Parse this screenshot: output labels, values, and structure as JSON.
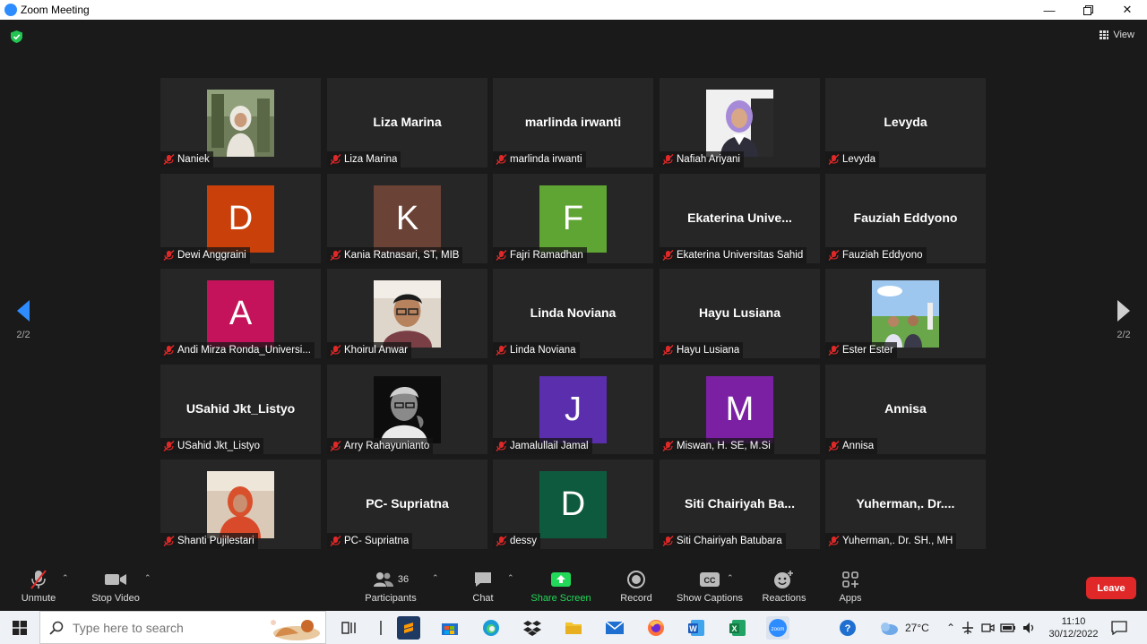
{
  "window": {
    "title": "Zoom Meeting"
  },
  "view_label": "View",
  "pagination": {
    "left": "2/2",
    "right": "2/2"
  },
  "tiles": [
    {
      "name": "Naniek",
      "kind": "photo",
      "photo": "photo-woman-hijab-garden"
    },
    {
      "name": "Liza Marina",
      "kind": "text",
      "display": "Liza Marina"
    },
    {
      "name": "marlinda irwanti",
      "kind": "text",
      "display": "marlinda irwanti"
    },
    {
      "name": "Nafiah Ariyani",
      "kind": "photo",
      "photo": "photo-woman-hijab-purple"
    },
    {
      "name": "Levyda",
      "kind": "text",
      "display": "Levyda"
    },
    {
      "name": "Dewi Anggraini",
      "kind": "avatar",
      "letter": "D",
      "color": "#c9400b"
    },
    {
      "name": "Kania Ratnasari, ST, MIB",
      "kind": "avatar",
      "letter": "K",
      "color": "#6b4236"
    },
    {
      "name": "Fajri Ramadhan",
      "kind": "avatar",
      "letter": "F",
      "color": "#5fa533"
    },
    {
      "name": "Ekaterina Universitas Sahid",
      "kind": "text",
      "display": "Ekaterina  Unive..."
    },
    {
      "name": "Fauziah Eddyono",
      "kind": "text",
      "display": "Fauziah Eddyono"
    },
    {
      "name": "Andi Mirza Ronda_Universi...",
      "kind": "avatar",
      "letter": "A",
      "color": "#c4135a"
    },
    {
      "name": "Khoirul Anwar",
      "kind": "photo",
      "photo": "photo-man-glasses"
    },
    {
      "name": "Linda Noviana",
      "kind": "text",
      "display": "Linda Noviana"
    },
    {
      "name": "Hayu Lusiana",
      "kind": "text",
      "display": "Hayu Lusiana"
    },
    {
      "name": "Ester Ester",
      "kind": "photo",
      "photo": "photo-couple-outdoor"
    },
    {
      "name": "USahid Jkt_Listyo",
      "kind": "text",
      "display": "USahid Jkt_Listyo"
    },
    {
      "name": "Arry Rahayunianto",
      "kind": "photo",
      "photo": "photo-man-bw"
    },
    {
      "name": "Jamalullail Jamal",
      "kind": "avatar",
      "letter": "J",
      "color": "#5a2ead"
    },
    {
      "name": "Miswan, H. SE, M.Si",
      "kind": "avatar",
      "letter": "M",
      "color": "#7b20a3"
    },
    {
      "name": "Annisa",
      "kind": "text",
      "display": "Annisa"
    },
    {
      "name": "Shanti Pujilestari",
      "kind": "photo",
      "photo": "photo-woman-red-hijab"
    },
    {
      "name": "PC- Supriatna",
      "kind": "text",
      "display": "PC- Supriatna"
    },
    {
      "name": "dessy",
      "kind": "avatar",
      "letter": "D",
      "color": "#0e5a3e"
    },
    {
      "name": "Siti Chairiyah Batubara",
      "kind": "text",
      "display": "Siti  Chairiyah  Ba..."
    },
    {
      "name": "Yuherman,. Dr. SH., MH",
      "kind": "text",
      "display": "Yuherman,.  Dr...."
    }
  ],
  "toolbar": {
    "unmute": "Unmute",
    "stop_video": "Stop Video",
    "participants": "Participants",
    "participants_count": "36",
    "chat": "Chat",
    "share_screen": "Share Screen",
    "record": "Record",
    "show_captions": "Show Captions",
    "reactions": "Reactions",
    "apps": "Apps",
    "leave": "Leave",
    "share_color": "#23d959",
    "leave_color": "#e02828"
  },
  "taskbar": {
    "search_placeholder": "Type here to search",
    "temperature": "27°C",
    "time": "11:10",
    "date": "30/12/2022"
  }
}
